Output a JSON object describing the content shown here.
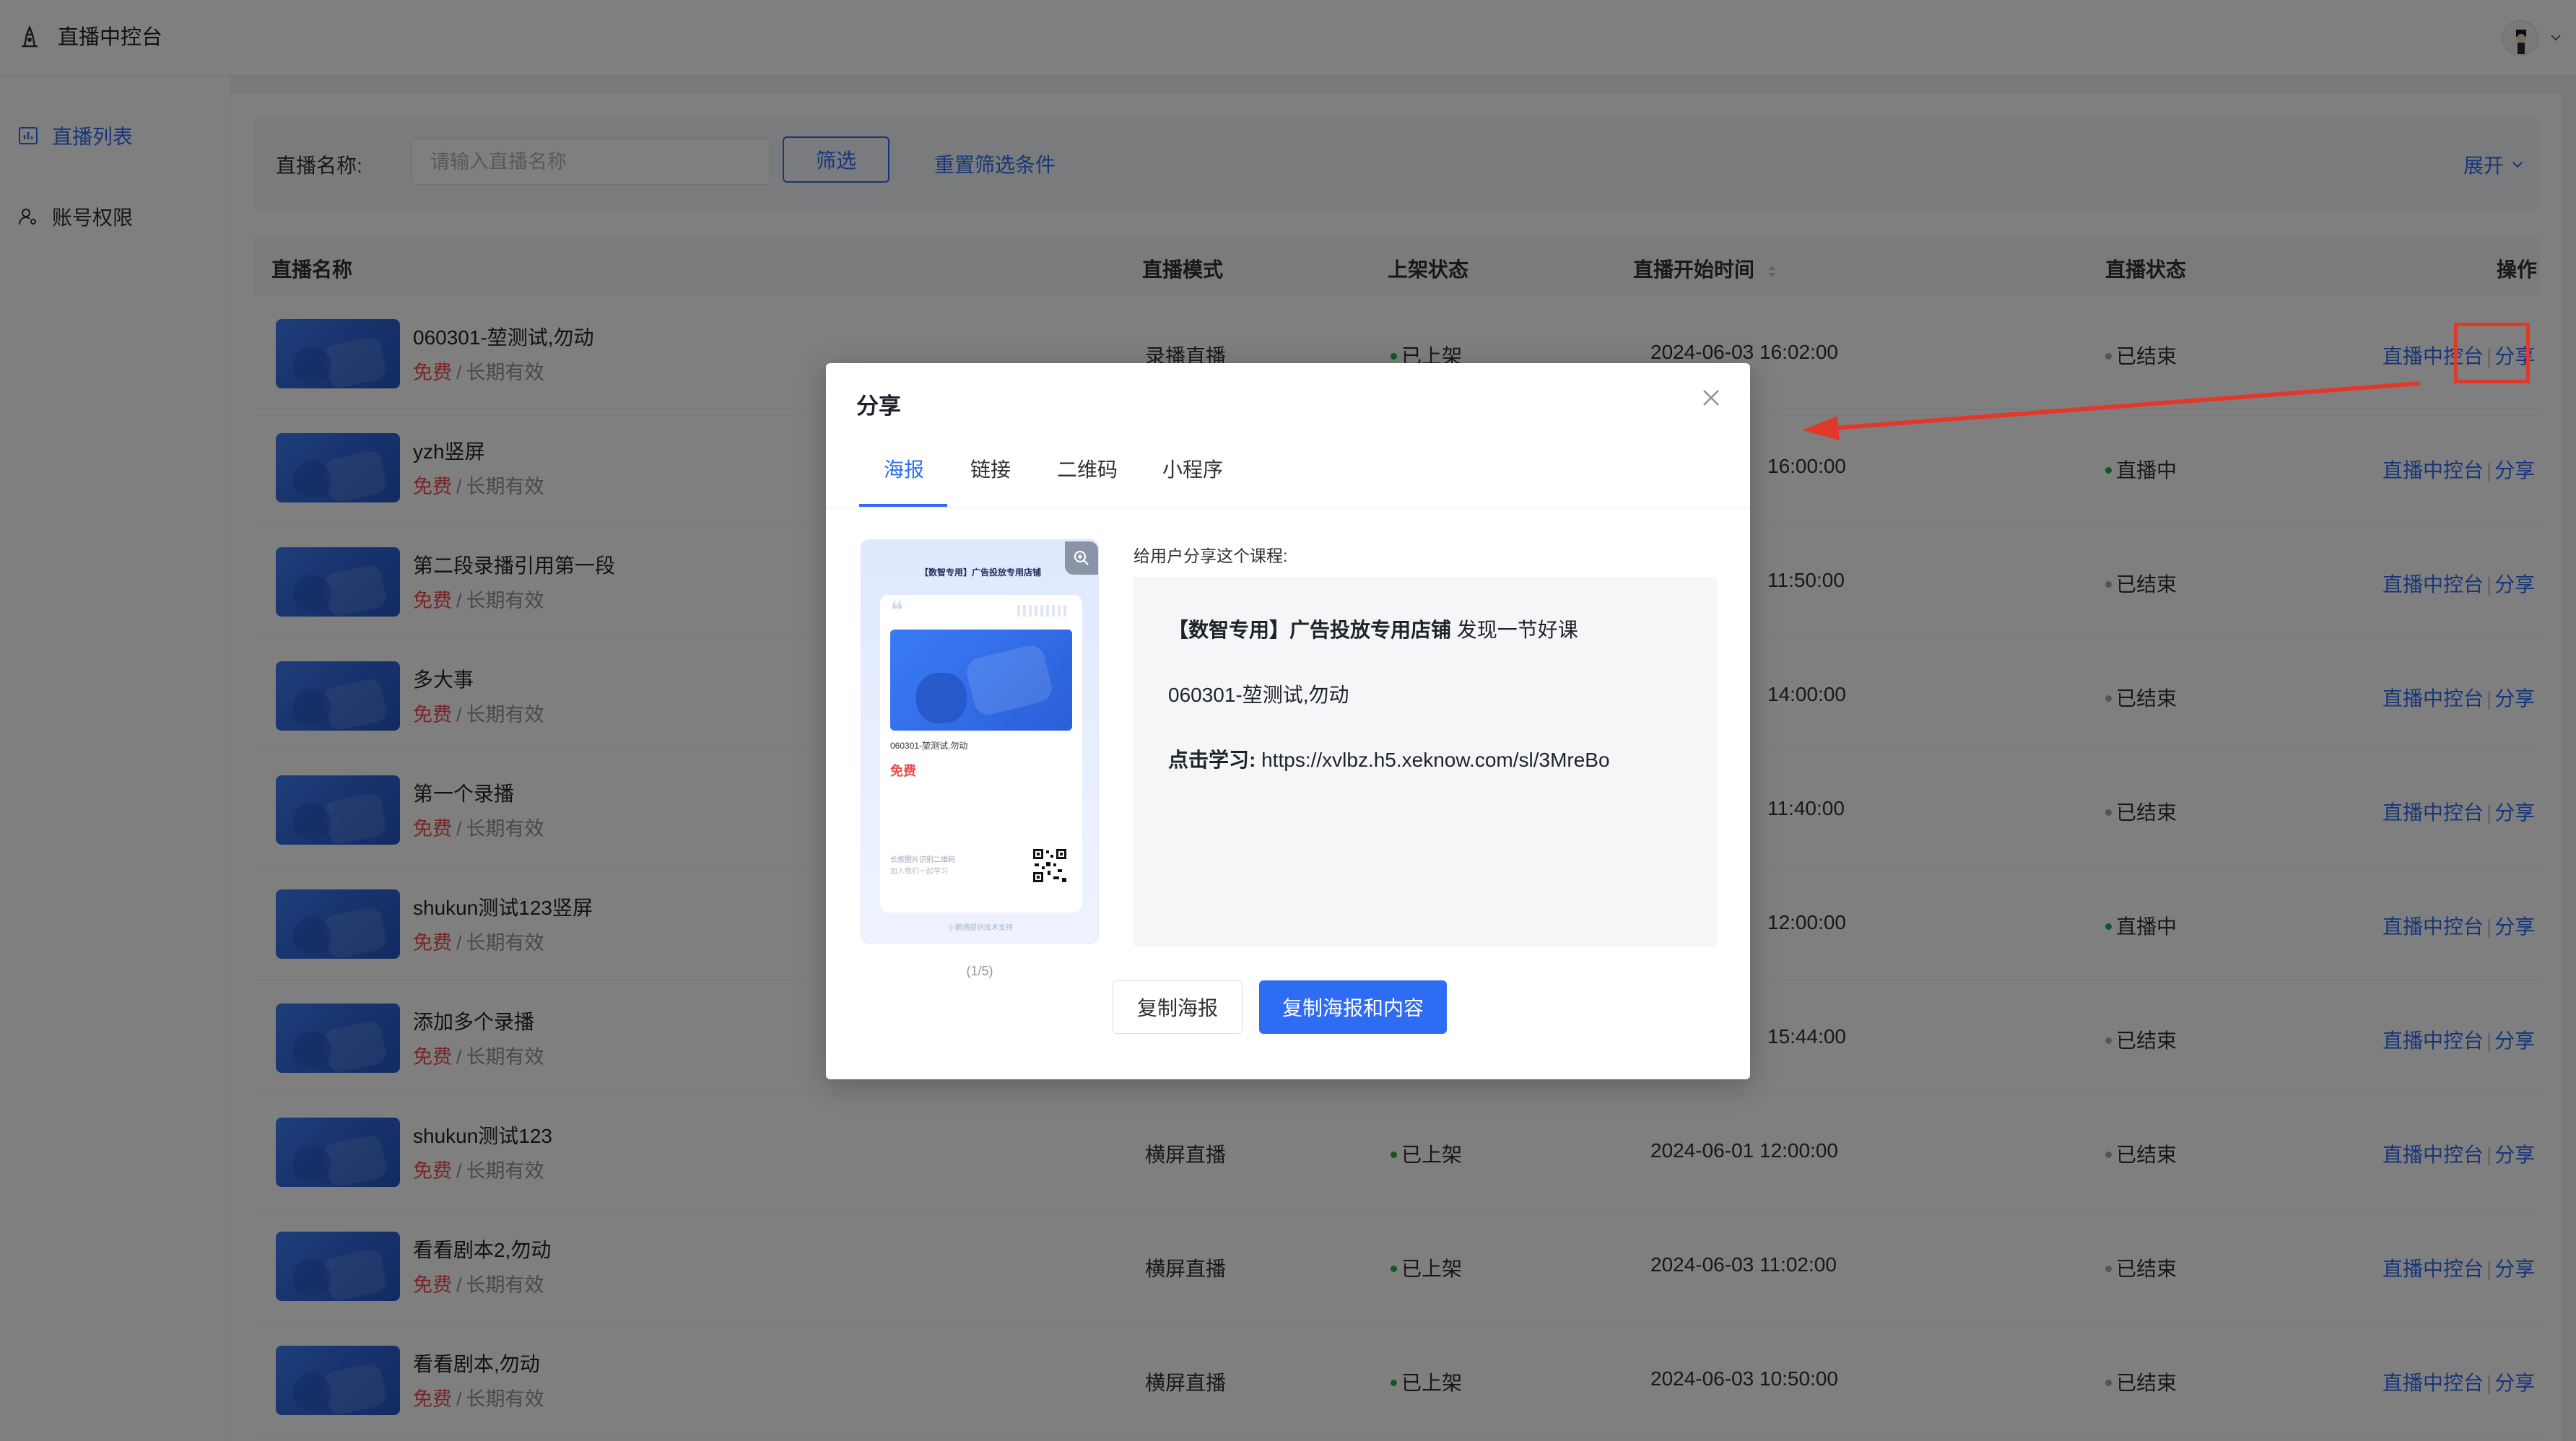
{
  "app": {
    "title": "直播中控台"
  },
  "sidebar": {
    "items": [
      {
        "label": "直播列表",
        "icon": "chart-bar-icon",
        "active": true
      },
      {
        "label": "账号权限",
        "icon": "user-key-icon",
        "active": false
      }
    ]
  },
  "filter": {
    "label": "直播名称:",
    "placeholder": "请输入直播名称",
    "value": "",
    "filter_button": "筛选",
    "reset_link": "重置筛选条件",
    "expand": "展开"
  },
  "table": {
    "headers": {
      "name": "直播名称",
      "mode": "直播模式",
      "listing": "上架状态",
      "start_time": "直播开始时间",
      "status": "直播状态",
      "ops": "操作"
    },
    "op_console": "直播中控台",
    "op_share": "分享",
    "rows": [
      {
        "title": "060301-堃测试,勿动",
        "price": "免费",
        "sep": "/",
        "validity": "长期有效",
        "mode": "录播直播",
        "listing": "已上架",
        "time": "2024-06-03 16:02:00",
        "status": "已结束",
        "status_color": "grey"
      },
      {
        "title": "yzh竖屏",
        "price": "免费",
        "sep": "/",
        "validity": "长期有效",
        "mode": "",
        "listing": "",
        "time": "16:00:00",
        "status": "直播中",
        "status_color": "green"
      },
      {
        "title": "第二段录播引用第一段",
        "price": "免费",
        "sep": "/",
        "validity": "长期有效",
        "mode": "",
        "listing": "",
        "time": "11:50:00",
        "status": "已结束",
        "status_color": "grey"
      },
      {
        "title": "多大事",
        "price": "免费",
        "sep": "/",
        "validity": "长期有效",
        "mode": "",
        "listing": "",
        "time": "14:00:00",
        "status": "已结束",
        "status_color": "grey"
      },
      {
        "title": "第一个录播",
        "price": "免费",
        "sep": "/",
        "validity": "长期有效",
        "mode": "",
        "listing": "",
        "time": "11:40:00",
        "status": "已结束",
        "status_color": "grey"
      },
      {
        "title": "shukun测试123竖屏",
        "price": "免费",
        "sep": "/",
        "validity": "长期有效",
        "mode": "",
        "listing": "",
        "time": "12:00:00",
        "status": "直播中",
        "status_color": "green"
      },
      {
        "title": "添加多个录播",
        "price": "免费",
        "sep": "/",
        "validity": "长期有效",
        "mode": "",
        "listing": "",
        "time": "15:44:00",
        "status": "已结束",
        "status_color": "grey"
      },
      {
        "title": "shukun测试123",
        "price": "免费",
        "sep": "/",
        "validity": "长期有效",
        "mode": "横屏直播",
        "listing": "已上架",
        "time": "2024-06-01 12:00:00",
        "status": "已结束",
        "status_color": "grey"
      },
      {
        "title": "看看剧本2,勿动",
        "price": "免费",
        "sep": "/",
        "validity": "长期有效",
        "mode": "横屏直播",
        "listing": "已上架",
        "time": "2024-06-03 11:02:00",
        "status": "已结束",
        "status_color": "grey"
      },
      {
        "title": "看看剧本,勿动",
        "price": "免费",
        "sep": "/",
        "validity": "长期有效",
        "mode": "横屏直播",
        "listing": "已上架",
        "time": "2024-06-03 10:50:00",
        "status": "已结束",
        "status_color": "grey"
      }
    ]
  },
  "modal": {
    "title": "分享",
    "tabs": [
      "海报",
      "链接",
      "二维码",
      "小程序"
    ],
    "active_tab": 0,
    "poster": {
      "shop": "【数智专用】广告投放专用店铺",
      "course_title": "060301-堃测试,勿动",
      "price": "免费",
      "hint1": "长按图片识别二维码",
      "hint2": "加入我们一起学习",
      "footer": "小鹅通提供技术支持",
      "page": "(1/5)"
    },
    "share_label": "给用户分享这个课程:",
    "share_text": {
      "shop": "【数智专用】广告投放专用店铺",
      "intro_suffix": " 发现一节好课",
      "course": "060301-堃测试,勿动",
      "link_label": "点击学习:",
      "link": "https://xvlbz.h5.xeknow.com/sl/3MreBo"
    },
    "buttons": {
      "copy_poster": "复制海报",
      "copy_all": "复制海报和内容"
    }
  },
  "colors": {
    "accent": "#2f6cf4",
    "price_red": "#f04a4a",
    "live_green": "#22b14c",
    "ended_grey": "#a8abb2",
    "annotation_red": "#e0392b"
  }
}
